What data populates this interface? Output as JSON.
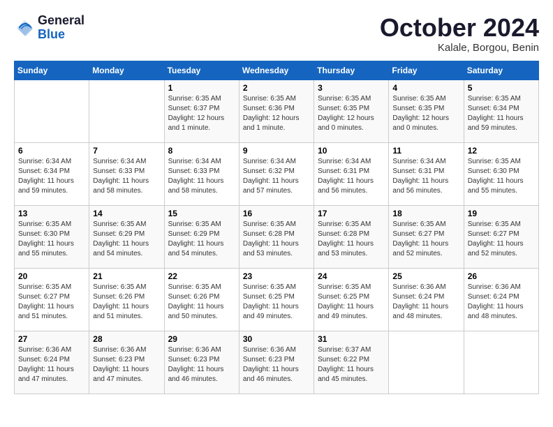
{
  "logo": {
    "line1": "General",
    "line2": "Blue"
  },
  "title": "October 2024",
  "location": "Kalale, Borgou, Benin",
  "weekdays": [
    "Sunday",
    "Monday",
    "Tuesday",
    "Wednesday",
    "Thursday",
    "Friday",
    "Saturday"
  ],
  "weeks": [
    [
      {
        "day": "",
        "info": ""
      },
      {
        "day": "",
        "info": ""
      },
      {
        "day": "1",
        "info": "Sunrise: 6:35 AM\nSunset: 6:37 PM\nDaylight: 12 hours and 1 minute."
      },
      {
        "day": "2",
        "info": "Sunrise: 6:35 AM\nSunset: 6:36 PM\nDaylight: 12 hours and 1 minute."
      },
      {
        "day": "3",
        "info": "Sunrise: 6:35 AM\nSunset: 6:35 PM\nDaylight: 12 hours and 0 minutes."
      },
      {
        "day": "4",
        "info": "Sunrise: 6:35 AM\nSunset: 6:35 PM\nDaylight: 12 hours and 0 minutes."
      },
      {
        "day": "5",
        "info": "Sunrise: 6:35 AM\nSunset: 6:34 PM\nDaylight: 11 hours and 59 minutes."
      }
    ],
    [
      {
        "day": "6",
        "info": "Sunrise: 6:34 AM\nSunset: 6:34 PM\nDaylight: 11 hours and 59 minutes."
      },
      {
        "day": "7",
        "info": "Sunrise: 6:34 AM\nSunset: 6:33 PM\nDaylight: 11 hours and 58 minutes."
      },
      {
        "day": "8",
        "info": "Sunrise: 6:34 AM\nSunset: 6:33 PM\nDaylight: 11 hours and 58 minutes."
      },
      {
        "day": "9",
        "info": "Sunrise: 6:34 AM\nSunset: 6:32 PM\nDaylight: 11 hours and 57 minutes."
      },
      {
        "day": "10",
        "info": "Sunrise: 6:34 AM\nSunset: 6:31 PM\nDaylight: 11 hours and 56 minutes."
      },
      {
        "day": "11",
        "info": "Sunrise: 6:34 AM\nSunset: 6:31 PM\nDaylight: 11 hours and 56 minutes."
      },
      {
        "day": "12",
        "info": "Sunrise: 6:35 AM\nSunset: 6:30 PM\nDaylight: 11 hours and 55 minutes."
      }
    ],
    [
      {
        "day": "13",
        "info": "Sunrise: 6:35 AM\nSunset: 6:30 PM\nDaylight: 11 hours and 55 minutes."
      },
      {
        "day": "14",
        "info": "Sunrise: 6:35 AM\nSunset: 6:29 PM\nDaylight: 11 hours and 54 minutes."
      },
      {
        "day": "15",
        "info": "Sunrise: 6:35 AM\nSunset: 6:29 PM\nDaylight: 11 hours and 54 minutes."
      },
      {
        "day": "16",
        "info": "Sunrise: 6:35 AM\nSunset: 6:28 PM\nDaylight: 11 hours and 53 minutes."
      },
      {
        "day": "17",
        "info": "Sunrise: 6:35 AM\nSunset: 6:28 PM\nDaylight: 11 hours and 53 minutes."
      },
      {
        "day": "18",
        "info": "Sunrise: 6:35 AM\nSunset: 6:27 PM\nDaylight: 11 hours and 52 minutes."
      },
      {
        "day": "19",
        "info": "Sunrise: 6:35 AM\nSunset: 6:27 PM\nDaylight: 11 hours and 52 minutes."
      }
    ],
    [
      {
        "day": "20",
        "info": "Sunrise: 6:35 AM\nSunset: 6:27 PM\nDaylight: 11 hours and 51 minutes."
      },
      {
        "day": "21",
        "info": "Sunrise: 6:35 AM\nSunset: 6:26 PM\nDaylight: 11 hours and 51 minutes."
      },
      {
        "day": "22",
        "info": "Sunrise: 6:35 AM\nSunset: 6:26 PM\nDaylight: 11 hours and 50 minutes."
      },
      {
        "day": "23",
        "info": "Sunrise: 6:35 AM\nSunset: 6:25 PM\nDaylight: 11 hours and 49 minutes."
      },
      {
        "day": "24",
        "info": "Sunrise: 6:35 AM\nSunset: 6:25 PM\nDaylight: 11 hours and 49 minutes."
      },
      {
        "day": "25",
        "info": "Sunrise: 6:36 AM\nSunset: 6:24 PM\nDaylight: 11 hours and 48 minutes."
      },
      {
        "day": "26",
        "info": "Sunrise: 6:36 AM\nSunset: 6:24 PM\nDaylight: 11 hours and 48 minutes."
      }
    ],
    [
      {
        "day": "27",
        "info": "Sunrise: 6:36 AM\nSunset: 6:24 PM\nDaylight: 11 hours and 47 minutes."
      },
      {
        "day": "28",
        "info": "Sunrise: 6:36 AM\nSunset: 6:23 PM\nDaylight: 11 hours and 47 minutes."
      },
      {
        "day": "29",
        "info": "Sunrise: 6:36 AM\nSunset: 6:23 PM\nDaylight: 11 hours and 46 minutes."
      },
      {
        "day": "30",
        "info": "Sunrise: 6:36 AM\nSunset: 6:23 PM\nDaylight: 11 hours and 46 minutes."
      },
      {
        "day": "31",
        "info": "Sunrise: 6:37 AM\nSunset: 6:22 PM\nDaylight: 11 hours and 45 minutes."
      },
      {
        "day": "",
        "info": ""
      },
      {
        "day": "",
        "info": ""
      }
    ]
  ]
}
